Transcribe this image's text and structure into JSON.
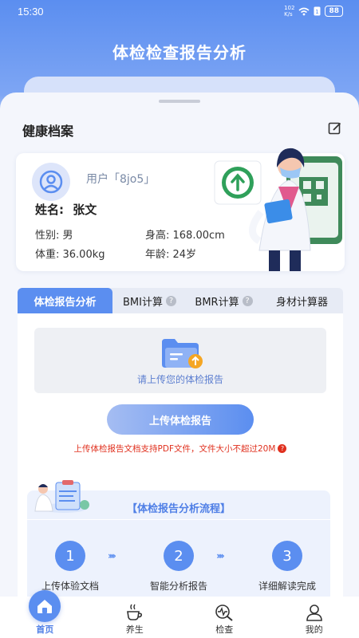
{
  "status_bar": {
    "time": "15:30",
    "network_speed": "102\nK/s",
    "battery": "88"
  },
  "header": {
    "title": "体检检查报告分析"
  },
  "profile": {
    "section_title": "健康档案",
    "user_label": "用户「8jo5」",
    "name_label": "姓名:",
    "name_value": "张文",
    "gender": "性别: 男",
    "height": "身高: 168.00cm",
    "weight": "体重: 36.00kg",
    "age": "年龄: 24岁"
  },
  "tabs": [
    {
      "label": "体检报告分析",
      "active": true
    },
    {
      "label": "BMI计算",
      "help": "?"
    },
    {
      "label": "BMR计算",
      "help": "?"
    },
    {
      "label": "身材计算器"
    }
  ],
  "upload": {
    "hint": "请上传您的体检报告",
    "button_label": "上传体检报告",
    "note": "上传体检报告文档支持PDF文件，文件大小不超过20M",
    "note_icon": "?"
  },
  "flow": {
    "title": "【体检报告分析流程】",
    "steps": [
      {
        "num": "1",
        "label": "上传体验文档"
      },
      {
        "num": "2",
        "label": "智能分析报告"
      },
      {
        "num": "3",
        "label": "详细解读完成"
      }
    ],
    "arrow": "››››"
  },
  "bottom_nav": [
    {
      "label": "首页",
      "icon": "home-icon",
      "active": true
    },
    {
      "label": "养生",
      "icon": "tea-cup-icon"
    },
    {
      "label": "检查",
      "icon": "search-heart-icon"
    },
    {
      "label": "我的",
      "icon": "user-icon"
    }
  ],
  "colors": {
    "primary": "#5b8ef0",
    "warning": "#e0301e",
    "background": "#f4f6fc"
  }
}
